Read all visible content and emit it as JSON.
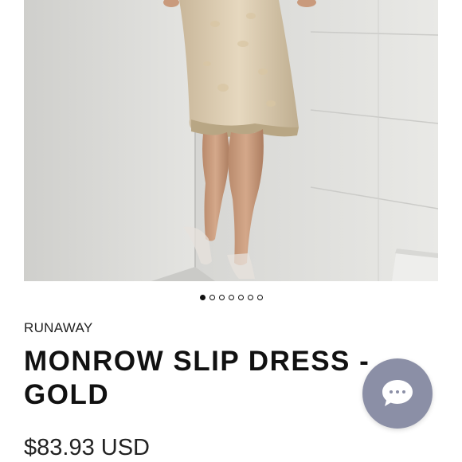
{
  "product": {
    "brand": "RUNAWAY",
    "title": "MONROW SLIP DRESS - GOLD",
    "price": "$83.93 USD"
  },
  "carousel": {
    "slide_count": 7,
    "active_index": 0
  },
  "icons": {
    "chat": "chat-bubble-icon"
  },
  "colors": {
    "chat_button": "#8b8fa6",
    "text": "#111111"
  }
}
